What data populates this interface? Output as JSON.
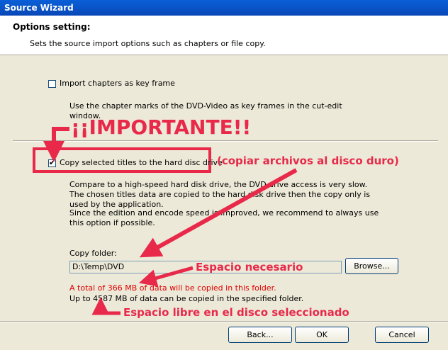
{
  "window": {
    "title": "Source Wizard"
  },
  "header": {
    "title": "Options setting:",
    "subtitle": "Sets the source import options such as chapters or file copy."
  },
  "options": {
    "chapters": {
      "label": "Import chapters as key frame",
      "checked": false,
      "description": "Use the chapter marks of the DVD-Video as key frames in the cut-edit window."
    },
    "copy_titles": {
      "label": "Copy selected titles to the hard disc drive",
      "checked": true,
      "description1": "Compare to a high-speed hard disk drive, the DVD drive access is very slow. The chosen titles data are copied to the hard disk drive then the copy only is used by the application.",
      "description2": "Since the edition and encode speed is improved, we recommend to always use this option if possible."
    }
  },
  "copy_folder": {
    "label": "Copy folder:",
    "value": "D:\\Temp\\DVD",
    "browse_label": "Browse..."
  },
  "status": {
    "required": "A total of 366 MB of data will be copied in this folder.",
    "available": "Up to 4587 MB of data can be copied in the specified folder."
  },
  "annotations": {
    "important": "¡¡IMPORTANTE!!",
    "copy_note": "(copiar archivos al disco duro)",
    "space_needed": "Espacio necesario",
    "free_space": "Espacio libre en el disco seleccionado"
  },
  "footer": {
    "back_label": "Back...",
    "ok_label": "OK",
    "cancel_label": "Cancel"
  },
  "colors": {
    "accent": "#e8294a",
    "title_bar": "#0a5fd8"
  }
}
